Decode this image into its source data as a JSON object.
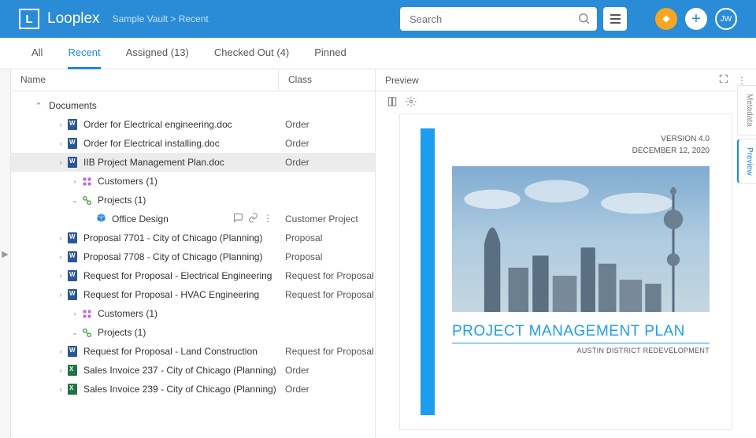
{
  "header": {
    "app_name": "Looplex",
    "breadcrumb": "Sample Vault  >  Recent",
    "search_placeholder": "Search",
    "avatar_initials": "JW"
  },
  "tabs": [
    {
      "label": "All",
      "active": false
    },
    {
      "label": "Recent",
      "active": true
    },
    {
      "label": "Assigned (13)",
      "active": false
    },
    {
      "label": "Checked Out (4)",
      "active": false
    },
    {
      "label": "Pinned",
      "active": false
    }
  ],
  "columns": {
    "name": "Name",
    "class": "Class"
  },
  "tree": {
    "root_label": "Documents",
    "items": [
      {
        "label": "Order for Electrical engineering.doc",
        "class": "Order",
        "icon": "word",
        "depth": 1,
        "chev": "right"
      },
      {
        "label": "Order for Electrical installing.doc",
        "class": "Order",
        "icon": "word",
        "depth": 1,
        "chev": "right"
      },
      {
        "label": "IIB Project Management Plan.doc",
        "class": "Order",
        "icon": "word",
        "depth": 1,
        "chev": "right",
        "selected": true
      },
      {
        "label": "Customers (1)",
        "class": "",
        "icon": "customers",
        "depth": 2,
        "chev": "right"
      },
      {
        "label": "Projects (1)",
        "class": "",
        "icon": "projects",
        "depth": 2,
        "chev": "down"
      },
      {
        "label": "Office Design",
        "class": "Customer Project",
        "icon": "cube",
        "depth": 3,
        "chev": "",
        "actions": true
      },
      {
        "label": "Proposal 7701 - City of Chicago (Planning)",
        "class": "Proposal",
        "icon": "word",
        "depth": 1,
        "chev": "right"
      },
      {
        "label": "Proposal 7708 - City of Chicago (Planning)",
        "class": "Proposal",
        "icon": "word",
        "depth": 1,
        "chev": "right"
      },
      {
        "label": "Request for Proposal - Electrical Engineering",
        "class": "Request for Proposal",
        "icon": "word",
        "depth": 1,
        "chev": "right"
      },
      {
        "label": "Request for Proposal - HVAC Engineering",
        "class": "Request for Proposal",
        "icon": "word",
        "depth": 1,
        "chev": "right"
      },
      {
        "label": "Customers (1)",
        "class": "",
        "icon": "customers",
        "depth": 2,
        "chev": "right"
      },
      {
        "label": "Projects (1)",
        "class": "",
        "icon": "projects",
        "depth": 2,
        "chev": "down"
      },
      {
        "label": "Request for Proposal - Land Construction",
        "class": "Request for Proposal",
        "icon": "word",
        "depth": 1,
        "chev": "right"
      },
      {
        "label": "Sales Invoice 237 - City of Chicago (Planning)",
        "class": "Order",
        "icon": "excel",
        "depth": 1,
        "chev": "right"
      },
      {
        "label": "Sales Invoice 239 - City of Chicago (Planning)",
        "class": "Order",
        "icon": "excel",
        "depth": 1,
        "chev": "right"
      }
    ]
  },
  "preview": {
    "header_label": "Preview",
    "doc": {
      "version": "VERSION 4.0",
      "date": "DECEMBER 12, 2020",
      "title": "PROJECT MANAGEMENT PLAN",
      "subtitle": "AUSTIN DISTRICT REDEVELOPMENT"
    }
  },
  "side_tabs": [
    {
      "label": "Metadata",
      "active": false
    },
    {
      "label": "Preview",
      "active": true
    }
  ]
}
